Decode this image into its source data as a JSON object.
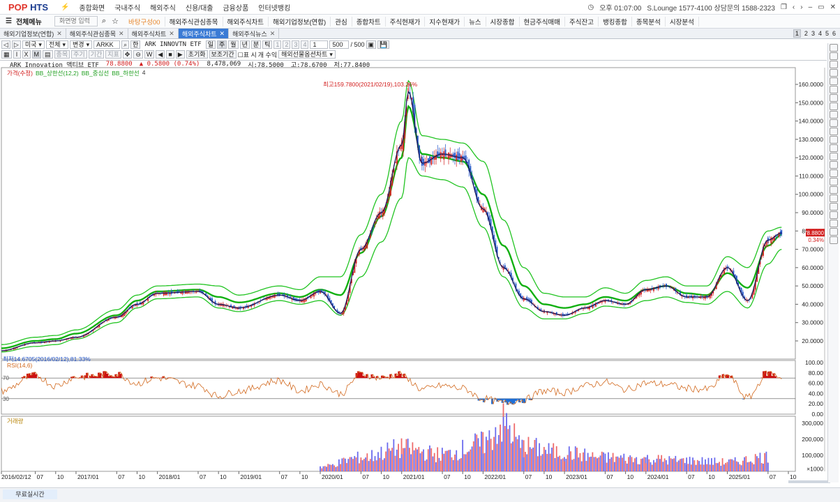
{
  "app": {
    "logo_a": "POP",
    "logo_b": " HTS",
    "menu": [
      "종합화면",
      "국내주식",
      "해외주식",
      "신용/대출",
      "금융상품",
      "인터넷뱅킹"
    ],
    "time": "오후 01:07:00",
    "support": "S.Lounge 1577-4100 상담문의 1588-2323"
  },
  "toolbar": {
    "all_menu": "전체메뉴",
    "screen_input_placeholder": "화면명 입력",
    "quick_links": [
      "바탕구성00",
      "해외주식관심종목",
      "해외주식차트",
      "해외기업정보(연합)",
      "관심",
      "종합차트",
      "주식현재가",
      "지수현재가",
      "뉴스",
      "시장종합",
      "현금주식매매",
      "주식잔고",
      "뱅킹종합",
      "종목분석",
      "시장분석"
    ]
  },
  "tabs": [
    {
      "label": "해외기업정보(연합)",
      "active": false
    },
    {
      "label": "해외주식관심종목",
      "active": false
    },
    {
      "label": "해외주식차트",
      "active": false
    },
    {
      "label": "해외주식차트",
      "active": true
    },
    {
      "label": "해외주식뉴스",
      "active": false
    }
  ],
  "page_tabs": [
    "1",
    "2",
    "3",
    "4",
    "5",
    "6"
  ],
  "controls": {
    "market": "미국",
    "filter": "전체",
    "mode": "변경",
    "ticker": "ARKK",
    "lang": "한",
    "name": "ARK INNOVTN ETF",
    "periods": [
      "일",
      "주",
      "월",
      "년",
      "분",
      "틱"
    ],
    "active_period": "주",
    "minute_opts": [
      "1",
      "2",
      "3",
      "4"
    ],
    "unit": "1",
    "count": "500",
    "count_max": "/ 500",
    "tool_icons": [
      "▦",
      "I",
      "X",
      "M",
      "▤"
    ],
    "ghost_fields": [
      "종목",
      "주기",
      "기간",
      "지표"
    ],
    "nav_btns": [
      "◀",
      "■",
      "▶"
    ],
    "reset": "초기화",
    "query": "보조기간",
    "table_label": "표 시",
    "price_opt": "개 수익",
    "overseas": "해외선물옵션차트"
  },
  "stock": {
    "name": "ARK Innovation 액티브 ETF",
    "price": "78.8800",
    "change": "▲ 0.5800 (0.74%)",
    "volume": "8,478,069",
    "open": "시:78.5000",
    "high": "고:78.6700",
    "low": "저:77.8400"
  },
  "legends": {
    "price": [
      "가격(수정)",
      "BB_상한선(12,2)",
      "BB_중심선",
      "BB_하한선",
      "4"
    ],
    "rsi": "RSI(14,6)",
    "volume": "거래량"
  },
  "annotations": {
    "high": "최고159.7800(2021/02/19),103.26%",
    "low": "최저14.6705(2016/02/12),81.33%",
    "cur_price": "78.8800",
    "cur_chg": "0.34%"
  },
  "colors": {
    "up": "#d21d1d",
    "down": "#1f52c8",
    "bb": "#22c422",
    "mid": "#11b011",
    "rsi": "#d2691e"
  },
  "bottom": {
    "tab": "무료실시간"
  },
  "chart_data": [
    {
      "type": "line",
      "title": "ARK Innovation 액티브 ETF",
      "x": [
        "2016/02",
        "2016/07",
        "2016/10",
        "2017/01",
        "2017/07",
        "2017/10",
        "2018/01",
        "2018/07",
        "2018/10",
        "2019/01",
        "2019/07",
        "2019/10",
        "2020/01",
        "2020/04",
        "2020/07",
        "2020/10",
        "2021/01",
        "2021/02",
        "2021/04",
        "2021/07",
        "2021/10",
        "2022/01",
        "2022/04",
        "2022/07",
        "2022/10",
        "2023/01",
        "2023/04",
        "2023/07",
        "2023/10",
        "2024/01",
        "2024/04",
        "2024/07",
        "2024/10",
        "2025/01",
        "2025/04",
        "2025/07",
        "2025/09"
      ],
      "series": [
        {
          "name": "가격(수정)",
          "values": [
            14.7,
            19,
            20,
            22,
            33,
            40,
            46,
            47,
            40,
            38,
            45,
            42,
            47,
            35,
            70,
            90,
            127,
            156,
            117,
            122,
            120,
            92,
            60,
            43,
            36,
            34,
            38,
            42,
            40,
            48,
            50,
            44,
            44,
            60,
            42,
            75,
            78.9
          ]
        },
        {
          "name": "BB_상한선(12,2)",
          "values": [
            18,
            22,
            23,
            26,
            37,
            45,
            50,
            51,
            50,
            45,
            50,
            48,
            55,
            55,
            78,
            100,
            140,
            162,
            132,
            130,
            128,
            118,
            86,
            60,
            46,
            44,
            44,
            49,
            46,
            53,
            55,
            50,
            50,
            66,
            60,
            80,
            82
          ]
        },
        {
          "name": "BB_중심선",
          "values": [
            16,
            20,
            21,
            24,
            34,
            42,
            47,
            48,
            44,
            41,
            46,
            44,
            48,
            45,
            68,
            88,
            120,
            148,
            122,
            120,
            118,
            100,
            72,
            50,
            40,
            38,
            40,
            44,
            42,
            48,
            50,
            46,
            45,
            57,
            49,
            72,
            78
          ]
        },
        {
          "name": "BB_하한선",
          "values": [
            14,
            17,
            18,
            21,
            30,
            38,
            43,
            44,
            38,
            36,
            42,
            40,
            42,
            34,
            55,
            74,
            98,
            120,
            110,
            108,
            104,
            82,
            55,
            38,
            32,
            32,
            35,
            39,
            38,
            42,
            44,
            41,
            40,
            47,
            38,
            62,
            70
          ]
        }
      ],
      "ylim": [
        12,
        168
      ]
    },
    {
      "type": "line",
      "title": "RSI(14,6)",
      "x": [
        "2016/02",
        "2016/07",
        "2016/10",
        "2017/01",
        "2017/07",
        "2017/10",
        "2018/01",
        "2018/07",
        "2018/10",
        "2019/01",
        "2019/07",
        "2019/10",
        "2020/01",
        "2020/04",
        "2020/07",
        "2020/10",
        "2021/01",
        "2021/02",
        "2021/04",
        "2021/07",
        "2021/10",
        "2022/01",
        "2022/04",
        "2022/07",
        "2022/10",
        "2023/01",
        "2023/04",
        "2023/07",
        "2023/10",
        "2024/01",
        "2024/04",
        "2024/07",
        "2024/10",
        "2025/01",
        "2025/04",
        "2025/07",
        "2025/09"
      ],
      "series": [
        {
          "name": "RSI(14,6)",
          "values": [
            45,
            75,
            55,
            72,
            78,
            60,
            70,
            55,
            35,
            45,
            65,
            45,
            58,
            40,
            78,
            70,
            78,
            65,
            48,
            55,
            50,
            30,
            22,
            28,
            45,
            42,
            55,
            62,
            48,
            60,
            58,
            50,
            48,
            75,
            32,
            80,
            72
          ]
        }
      ],
      "ylim": [
        0,
        100
      ]
    },
    {
      "type": "bar",
      "title": "거래량",
      "x": [
        "2020/01",
        "2020/07",
        "2021/01",
        "2021/07",
        "2022/01",
        "2022/04",
        "2022/07",
        "2023/01",
        "2023/07",
        "2024/01",
        "2024/07",
        "2025/01",
        "2025/07"
      ],
      "values": [
        30000,
        90000,
        150000,
        110000,
        180000,
        310000,
        160000,
        120000,
        90000,
        80000,
        70000,
        60000,
        95000
      ],
      "ylim": [
        0,
        330000
      ]
    }
  ],
  "axes": {
    "price_ticks": [
      "160.0000",
      "150.0000",
      "140.0000",
      "130.0000",
      "120.0000",
      "110.0000",
      "100.0000",
      "90.0000",
      "80.0000",
      "70.0000",
      "60.0000",
      "50.0000",
      "40.0000",
      "30.0000",
      "20.0000"
    ],
    "rsi_ticks": [
      "100.00",
      "80.00",
      "60.00",
      "40.00",
      "20.00",
      "0.00"
    ],
    "rsi_levels": [
      "70",
      "30"
    ],
    "vol_ticks": [
      "300,000",
      "200,000",
      "100,000",
      "×1000"
    ],
    "x_labels": [
      "2016/02/12",
      "07",
      "10",
      "2017/01",
      "07",
      "10",
      "2018/01",
      "07",
      "10",
      "2019/01",
      "07",
      "10",
      "2020/01",
      "07",
      "10",
      "2021/01",
      "07",
      "10",
      "2022/01",
      "07",
      "10",
      "2023/01",
      "07",
      "10",
      "2024/01",
      "07",
      "10",
      "2025/01",
      "07",
      "10"
    ]
  }
}
